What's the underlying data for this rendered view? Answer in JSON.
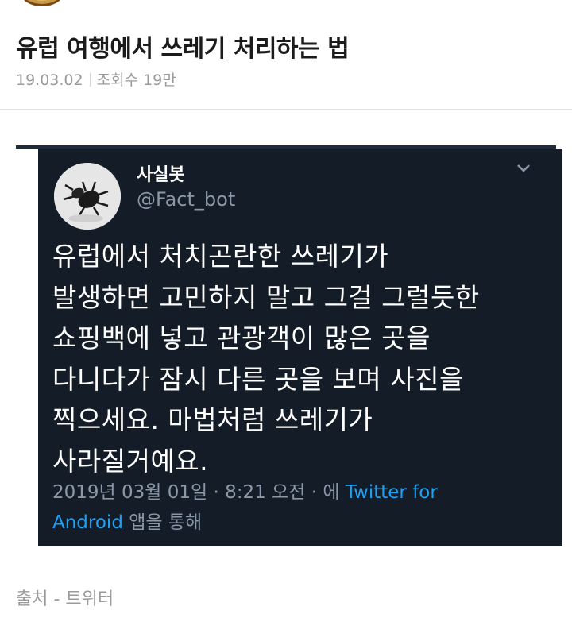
{
  "post": {
    "title": "유럽 여행에서 쓰레기 처리하는 법",
    "date": "19.03.02",
    "views": "조회수 19만"
  },
  "tweet": {
    "name": "사실봇",
    "handle": "@Fact_bot",
    "lines": [
      "유럽에서 처치곤란한 쓰레기가",
      "발생하면 고민하지 말고 그걸 그럴듯한",
      "쇼핑백에 넣고 관광객이 많은 곳을",
      "다니다가 잠시 다른 곳을 보며 사진을",
      "찍으세요. 마법처럼 쓰레기가",
      "사라질거예요."
    ],
    "timestamp": "2019년 03월 01일 · 8:21 오전 · 에 ",
    "client_prefix": "Twitter for",
    "client_suffix": "Android",
    "via_text": " 앱을 통해",
    "avatar_icon": "beetle-icon",
    "menu_icon": "chevron-down-icon"
  },
  "source": "출처 - 트위터",
  "colors": {
    "tweet_bg": "#141c28",
    "link": "#1ea1f2",
    "muted": "#8a98a7"
  }
}
